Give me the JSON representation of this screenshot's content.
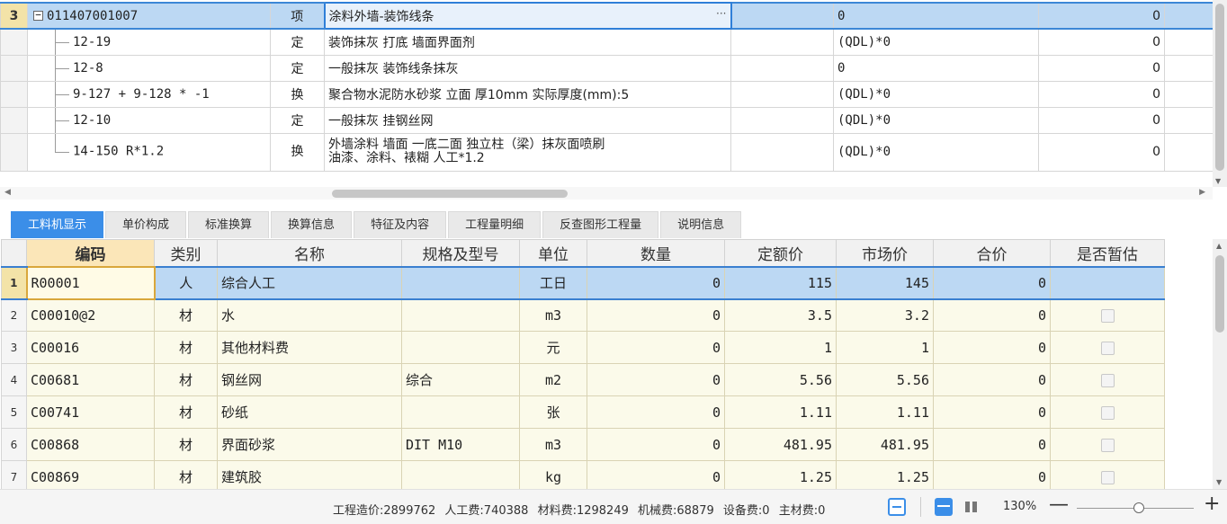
{
  "top_grid": {
    "rows": [
      {
        "no": "3",
        "code": "011407001007",
        "type": "项",
        "name": "涂料外墙-装饰线条",
        "expr": "0",
        "val": "0",
        "selected": true
      },
      {
        "no": "",
        "code": "12-19",
        "type": "定",
        "name": "装饰抹灰 打底 墙面界面剂",
        "expr": "(QDL)*0",
        "val": "0"
      },
      {
        "no": "",
        "code": "12-8",
        "type": "定",
        "name": "一般抹灰 装饰线条抹灰",
        "expr": "0",
        "val": "0"
      },
      {
        "no": "",
        "code": "9-127 + 9-128 * -1",
        "type": "换",
        "name": "聚合物水泥防水砂浆 立面 厚10mm  实际厚度(mm):5",
        "expr": "(QDL)*0",
        "val": "0"
      },
      {
        "no": "",
        "code": "12-10",
        "type": "定",
        "name": "一般抹灰 挂钢丝网",
        "expr": "(QDL)*0",
        "val": "0"
      },
      {
        "no": "",
        "code": "14-150 R*1.2",
        "type": "换",
        "name_line1": "外墙涂料 墙面 一底二面  独立柱（梁）抹灰面喷刷",
        "name_line2": "油漆、涂料、裱糊 人工*1.2",
        "expr": "(QDL)*0",
        "val": "0"
      }
    ],
    "ellipsis": "···"
  },
  "tabs": [
    "工料机显示",
    "单价构成",
    "标准换算",
    "换算信息",
    "特征及内容",
    "工程量明细",
    "反查图形工程量",
    "说明信息"
  ],
  "bottom_grid": {
    "headers": [
      "编码",
      "类别",
      "名称",
      "规格及型号",
      "单位",
      "数量",
      "定额价",
      "市场价",
      "合价",
      "是否暂估"
    ],
    "rows": [
      {
        "no": "1",
        "code": "R00001",
        "cat": "人",
        "name": "综合人工",
        "spec": "",
        "unit": "工日",
        "qty": "0",
        "quota": "115",
        "market": "145",
        "total": "0",
        "est": ""
      },
      {
        "no": "2",
        "code": "C00010@2",
        "cat": "材",
        "name": "水",
        "spec": "",
        "unit": "m3",
        "qty": "0",
        "quota": "3.5",
        "market": "3.2",
        "total": "0",
        "est": "checkbox"
      },
      {
        "no": "3",
        "code": "C00016",
        "cat": "材",
        "name": "其他材料费",
        "spec": "",
        "unit": "元",
        "qty": "0",
        "quota": "1",
        "market": "1",
        "total": "0",
        "est": "checkbox"
      },
      {
        "no": "4",
        "code": "C00681",
        "cat": "材",
        "name": "钢丝网",
        "spec": "综合",
        "unit": "m2",
        "qty": "0",
        "quota": "5.56",
        "market": "5.56",
        "total": "0",
        "est": "checkbox"
      },
      {
        "no": "5",
        "code": "C00741",
        "cat": "材",
        "name": "砂纸",
        "spec": "",
        "unit": "张",
        "qty": "0",
        "quota": "1.11",
        "market": "1.11",
        "total": "0",
        "est": "checkbox"
      },
      {
        "no": "6",
        "code": "C00868",
        "cat": "材",
        "name": "界面砂浆",
        "spec": "DIT M10",
        "unit": "m3",
        "qty": "0",
        "quota": "481.95",
        "market": "481.95",
        "total": "0",
        "est": "checkbox"
      },
      {
        "no": "7",
        "code": "C00869",
        "cat": "材",
        "name": "建筑胶",
        "spec": "",
        "unit": "kg",
        "qty": "0",
        "quota": "1.25",
        "market": "1.25",
        "total": "0",
        "est": "checkbox"
      }
    ]
  },
  "status": {
    "cost": "工程造价:2899762",
    "labor": "人工费:740388",
    "material": "材料费:1298249",
    "machine": "机械费:68879",
    "equipment": "设备费:0",
    "main_material": "主材费:0",
    "zoom": "130%",
    "zoom_out": "—",
    "zoom_in": "+"
  },
  "colors": {
    "accent": "#3b8ee8",
    "selected_row": "#bcd8f3",
    "grid_cell": "#fbfaea"
  }
}
